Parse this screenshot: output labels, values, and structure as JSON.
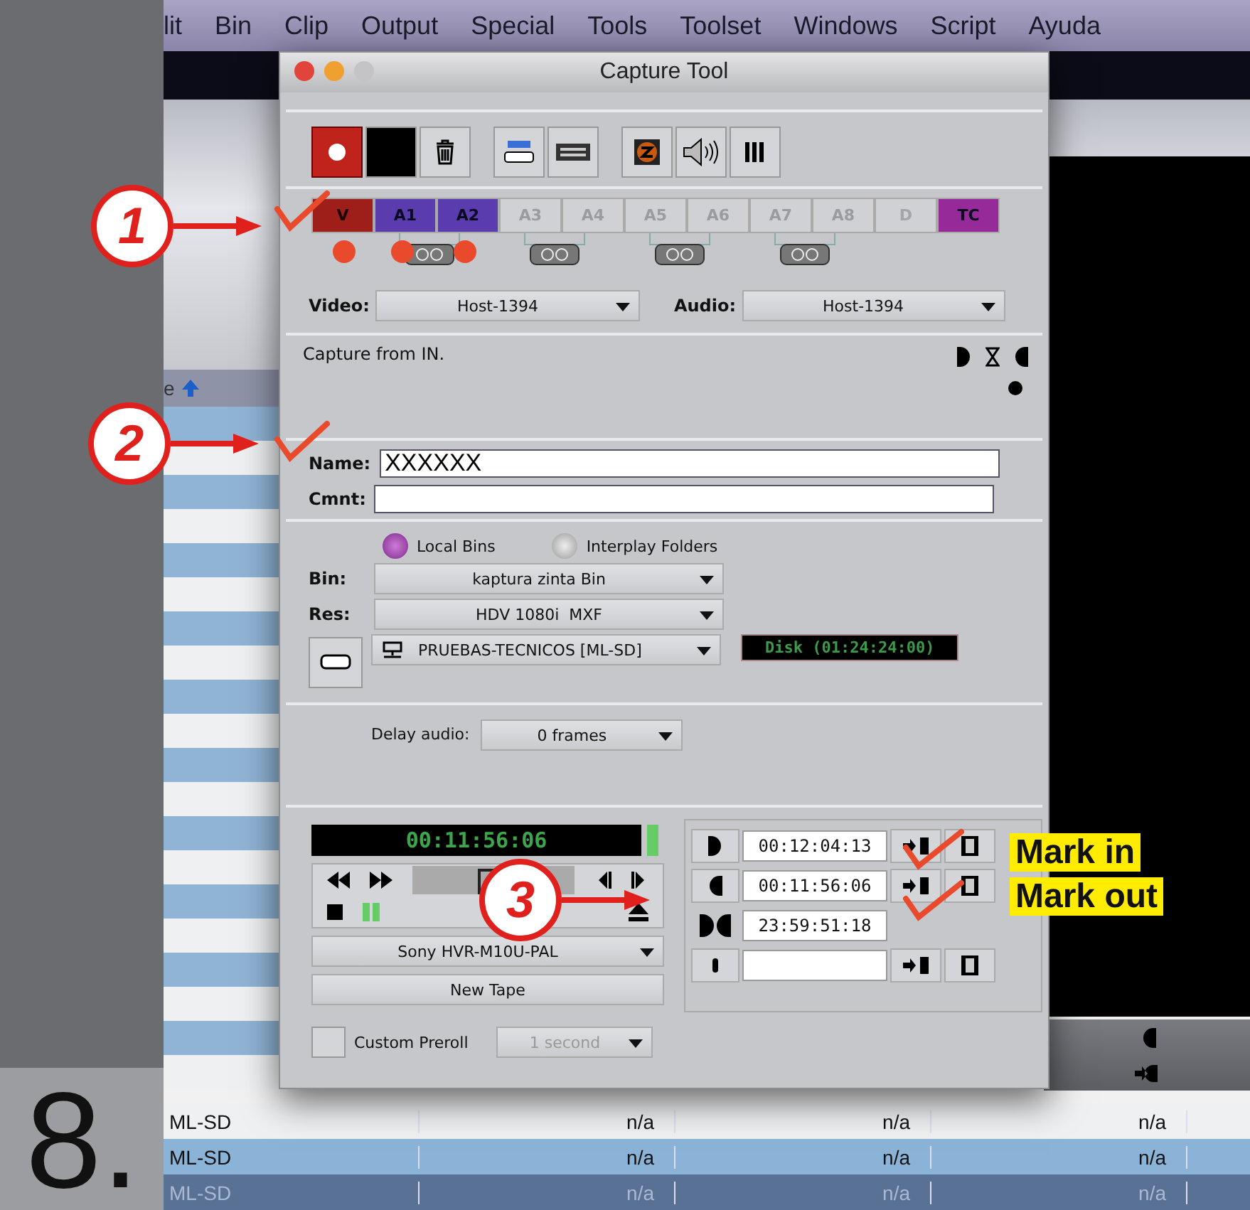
{
  "page_number": "8.",
  "menu_bar": [
    "lit",
    "Bin",
    "Clip",
    "Output",
    "Special",
    "Tools",
    "Toolset",
    "Windows",
    "Script",
    "Ayuda"
  ],
  "bin_header": "e",
  "bin_rows": [
    {
      "cells": [
        "ML-SD",
        "n/a",
        "n/a",
        "n/a"
      ],
      "selected": false
    },
    {
      "cells": [
        "ML-SD",
        "n/a",
        "n/a",
        "n/a"
      ],
      "selected": false
    },
    {
      "cells": [
        "ML-SD",
        "n/a",
        "n/a",
        "n/a"
      ],
      "selected": true
    }
  ],
  "capture_tool": {
    "title": "Capture Tool",
    "tracks": [
      {
        "label": "V",
        "kind": "video",
        "on": true
      },
      {
        "label": "A1",
        "kind": "audio",
        "on": true
      },
      {
        "label": "A2",
        "kind": "audio",
        "on": true
      },
      {
        "label": "A3",
        "kind": "audio",
        "on": false
      },
      {
        "label": "A4",
        "kind": "audio",
        "on": false
      },
      {
        "label": "A5",
        "kind": "audio",
        "on": false
      },
      {
        "label": "A6",
        "kind": "audio",
        "on": false
      },
      {
        "label": "A7",
        "kind": "audio",
        "on": false
      },
      {
        "label": "A8",
        "kind": "audio",
        "on": false
      },
      {
        "label": "D",
        "kind": "data",
        "on": false
      },
      {
        "label": "TC",
        "kind": "timecode",
        "on": true
      }
    ],
    "video_input": {
      "label": "Video:",
      "value": "Host-1394"
    },
    "audio_input": {
      "label": "Audio:",
      "value": "Host-1394"
    },
    "message": "Capture from IN.",
    "name_field": {
      "label": "Name:",
      "value": "XXXXXX"
    },
    "comment_field": {
      "label": "Cmnt:"
    },
    "bin_target": [
      {
        "label": "Local Bins",
        "selected": true
      },
      {
        "label": "Interplay Folders",
        "selected": false
      }
    ],
    "bin": {
      "label": "Bin:",
      "value": "kaptura zinta Bin"
    },
    "res": {
      "label": "Res:",
      "value": "HDV 1080i  MXF"
    },
    "drive": "PRUEBAS-TECNICOS [ML-SD]",
    "disk": "Disk (01:24:24:00)",
    "delay": {
      "label": "Delay audio:",
      "value": "0 frames"
    },
    "timecode": "00:11:56:06",
    "deck": "Sony HVR-M10U-PAL",
    "new_tape": "New Tape",
    "custom_preroll": {
      "label": "Custom Preroll",
      "checked": false,
      "value": "1 second",
      "disabled": true
    },
    "marks": [
      {
        "kind": "in",
        "value": "00:12:04:13"
      },
      {
        "kind": "out",
        "value": "00:11:56:06"
      },
      {
        "kind": "duration",
        "value": "23:59:51:18"
      },
      {
        "kind": "tape"
      }
    ]
  },
  "annotations": {
    "steps": [
      "1",
      "2",
      "3"
    ],
    "labels": [
      "Mark in",
      "Mark out"
    ]
  }
}
